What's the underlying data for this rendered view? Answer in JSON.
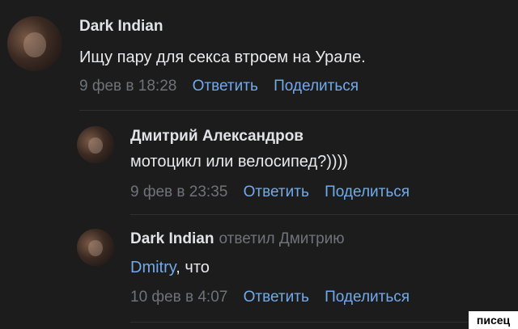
{
  "comments": [
    {
      "author": "Dark Indian",
      "reply_to": "",
      "text": "Ищу пару для секса втроем на Урале.",
      "date": "9 фев в 18:28",
      "reply_label": "Ответить",
      "share_label": "Поделиться"
    },
    {
      "author": "Дмитрий Александров",
      "reply_to": "",
      "text": "мотоцикл или велосипед?))))",
      "date": "9 фев в 23:35",
      "reply_label": "Ответить",
      "share_label": "Поделиться"
    },
    {
      "author": "Dark Indian",
      "reply_to": "ответил Дмитрию",
      "mention": "Dmitry",
      "text": ", что",
      "date": "10 фев в 4:07",
      "reply_label": "Ответить",
      "share_label": "Поделиться"
    }
  ],
  "watermark": "писец",
  "colors": {
    "background": "#1c1c1d",
    "link": "#71aaeb",
    "muted": "#6f7378",
    "text": "#e1e3e6"
  }
}
